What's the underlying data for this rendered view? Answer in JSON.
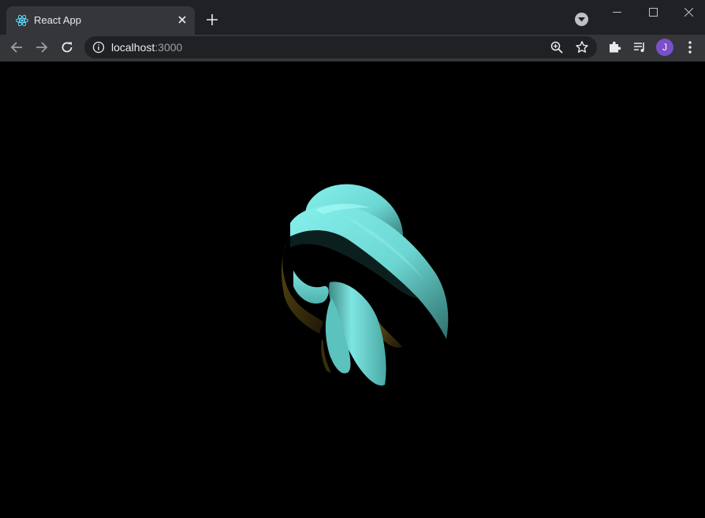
{
  "browser": {
    "tab": {
      "title": "React App",
      "favicon": "react-logo-icon"
    },
    "new_tab_icon": "plus-icon",
    "tab_search_icon": "chevron-down-icon",
    "window_controls": [
      "minimize-icon",
      "maximize-icon",
      "close-icon"
    ],
    "nav": {
      "back_icon": "arrow-left-icon",
      "forward_icon": "arrow-right-icon",
      "reload_icon": "reload-icon"
    },
    "address": {
      "host": "localhost",
      "port": ":3000",
      "info_icon": "info-icon",
      "zoom_icon": "zoom-in-icon",
      "bookmark_icon": "star-icon"
    },
    "extensions_icon": "puzzle-icon",
    "media_icon": "media-controls-icon",
    "profile_initial": "J",
    "menu_icon": "kebab-menu-icon",
    "colors": {
      "tabstrip": "#202124",
      "toolbar": "#35363a",
      "avatar": "#7b4fc9",
      "react_logo": "#61dafb",
      "knot_surface": "#7ee6e2",
      "knot_shadow": "#3d2f0a"
    }
  },
  "page": {
    "background": "#000000",
    "scene": "torus-knot-3d"
  }
}
